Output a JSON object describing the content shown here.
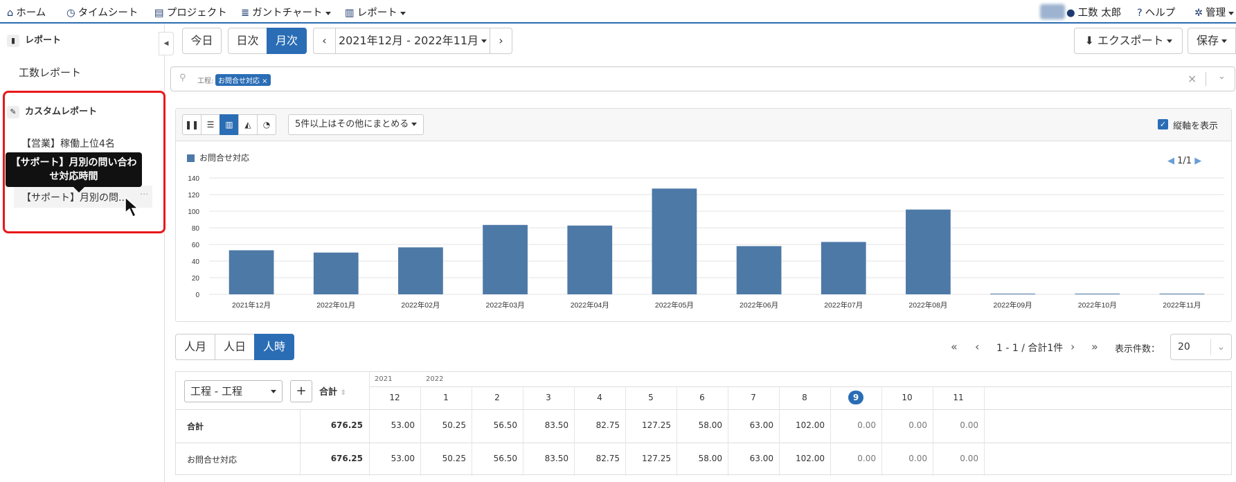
{
  "nav": {
    "home": "ホーム",
    "timesheet": "タイムシート",
    "project": "プロジェクト",
    "gantt": "ガントチャート",
    "report": "レポート",
    "user": "工数 太郎",
    "help": "ヘルプ",
    "admin": "管理"
  },
  "sidebar": {
    "report_header": "レポート",
    "work_report": "工数レポート",
    "custom_header": "カスタムレポート",
    "items": [
      "【営業】稼働上位4名",
      "【サポート】月別の問..."
    ],
    "tooltip": "【サポート】月別の問い合わせ対応時間"
  },
  "toolbar": {
    "today": "今日",
    "daily": "日次",
    "monthly": "月次",
    "range": "2021年12月 - 2022年11月",
    "export": "エクスポート",
    "save": "保存"
  },
  "filter": {
    "label": "工程:",
    "chip": "お問合せ対応",
    "clear": "×"
  },
  "chart_toolbar": {
    "group_option": "5件以上はその他にまとめる",
    "show_vertical": "縦軸を表示",
    "page": "1/1"
  },
  "chart_data": {
    "type": "bar",
    "legend": "お問合せ対応",
    "categories": [
      "2021年12月",
      "2022年01月",
      "2022年02月",
      "2022年03月",
      "2022年04月",
      "2022年05月",
      "2022年06月",
      "2022年07月",
      "2022年08月",
      "2022年09月",
      "2022年10月",
      "2022年11月"
    ],
    "values": [
      53.0,
      50.25,
      56.5,
      83.5,
      82.75,
      127.25,
      58.0,
      63.0,
      102.0,
      0,
      0,
      0
    ],
    "yticks": [
      "0",
      "20",
      "40",
      "60",
      "80",
      "100",
      "120",
      "140"
    ],
    "ylim": [
      0,
      140
    ],
    "color": "#4d79a7"
  },
  "units": {
    "month": "人月",
    "day": "人日",
    "hour": "人時"
  },
  "pagination": {
    "info": "1 - 1 / 合計1件",
    "per_page_label": "表示件数：",
    "per_page": "20"
  },
  "table": {
    "group_select": "工程 - 工程",
    "add": "+",
    "total_header": "合計",
    "year_2021": "2021",
    "year_2022": "2022",
    "months": [
      "12",
      "1",
      "2",
      "3",
      "4",
      "5",
      "6",
      "7",
      "8",
      "9",
      "10",
      "11"
    ],
    "rows": [
      {
        "label": "合計",
        "total": "676.25",
        "values": [
          "53.00",
          "50.25",
          "56.50",
          "83.50",
          "82.75",
          "127.25",
          "58.00",
          "63.00",
          "102.00",
          "0.00",
          "0.00",
          "0.00"
        ]
      },
      {
        "label": "お問合せ対応",
        "total": "676.25",
        "values": [
          "53.00",
          "50.25",
          "56.50",
          "83.50",
          "82.75",
          "127.25",
          "58.00",
          "63.00",
          "102.00",
          "0.00",
          "0.00",
          "0.00"
        ]
      }
    ]
  }
}
